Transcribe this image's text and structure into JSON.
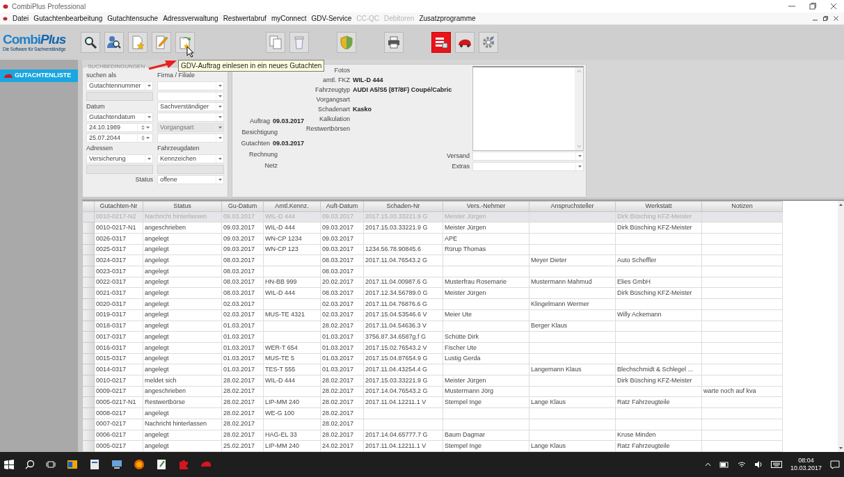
{
  "window": {
    "title": "CombiPlus Professional"
  },
  "menu": [
    {
      "label": "Datei",
      "disabled": false
    },
    {
      "label": "Gutachtenbearbeitung",
      "disabled": false
    },
    {
      "label": "Gutachtensuche",
      "disabled": false
    },
    {
      "label": "Adressverwaltung",
      "disabled": false
    },
    {
      "label": "Restwertabruf",
      "disabled": false
    },
    {
      "label": "myConnect",
      "disabled": false
    },
    {
      "label": "GDV-Service",
      "disabled": false
    },
    {
      "label": "CC-QC",
      "disabled": true
    },
    {
      "label": "Debitoren",
      "disabled": true
    },
    {
      "label": "Zusatzprogramme",
      "disabled": false
    }
  ],
  "logo": {
    "name": [
      "Combi",
      "Plus"
    ],
    "tagline": "Die Software für Sachverständige"
  },
  "toolbar": [
    {
      "kind": "search",
      "highlighted": false
    },
    {
      "kind": "person-search",
      "highlighted": false
    },
    {
      "kind": "new-document",
      "highlighted": false
    },
    {
      "kind": "edit",
      "highlighted": false
    },
    {
      "kind": "import",
      "highlighted": false
    },
    {
      "kind": "copy",
      "highlighted": false
    },
    {
      "kind": "trash",
      "highlighted": false
    },
    {
      "kind": "shield",
      "highlighted": false
    },
    {
      "kind": "print",
      "highlighted": false
    },
    {
      "kind": "list",
      "highlighted": true
    },
    {
      "kind": "car",
      "highlighted": false
    },
    {
      "kind": "gear",
      "highlighted": false
    }
  ],
  "tooltip": "GDV-Auftrag einlesen in ein neues Gutachten",
  "sidebar": {
    "items": [
      {
        "label": "GUTACHTENLISTE",
        "selected": true
      }
    ]
  },
  "search": {
    "legend": "SUCHBEDINGUNGEN",
    "rows": [
      [
        {
          "kind": "label",
          "text": "suchen als"
        },
        {
          "kind": "label",
          "text": "Firma / Filiale"
        }
      ],
      [
        {
          "kind": "select",
          "value": "Gutachtennummer"
        },
        {
          "kind": "select"
        }
      ],
      [
        {
          "kind": "input",
          "disabled": true
        },
        {
          "kind": "select"
        }
      ],
      [
        {
          "kind": "label",
          "text": "Datum"
        },
        {
          "kind": "select",
          "value": "Sachverständiger"
        }
      ],
      [
        {
          "kind": "select",
          "value": "Gutachtendatum"
        },
        {
          "kind": "select"
        }
      ],
      [
        {
          "kind": "date",
          "value": "24.10.1989"
        },
        {
          "kind": "select",
          "value": "Vorgangsart",
          "disabled": true
        }
      ],
      [
        {
          "kind": "date",
          "value": "25.07.2044"
        },
        {
          "kind": "select"
        }
      ],
      [
        {
          "kind": "label",
          "text": "Adressen"
        },
        {
          "kind": "label",
          "text": "Fahrzeugdaten"
        }
      ],
      [
        {
          "kind": "select",
          "value": "Versicherung"
        },
        {
          "kind": "select",
          "value": "Kennzeichen"
        }
      ],
      [
        {
          "kind": "input",
          "disabled": true
        },
        {
          "kind": "input",
          "disabled": true
        }
      ],
      [
        {
          "kind": "label_right",
          "text": "Status"
        },
        {
          "kind": "select",
          "value": "offene"
        }
      ]
    ]
  },
  "info": {
    "dates": [
      {
        "label": "Auftrag",
        "value": "09.03.2017"
      },
      {
        "label": "Besichtigung"
      },
      {
        "label": "Gutachten",
        "value": "09.03.2017"
      },
      {
        "label": "Rechnung"
      },
      {
        "label": "Netz"
      }
    ],
    "facts": [
      {
        "label": "Fotos"
      },
      {
        "label": "amtl. FKZ",
        "value": "WIL-D 444"
      },
      {
        "label": "Fahrzeugtyp",
        "value": "AUDI A5/S5 (8T/8F) Coupé/Cabric"
      },
      {
        "label": "Vorgangsart"
      },
      {
        "label": "Schadenart",
        "value": "Kasko"
      },
      {
        "label": "Kalkulation"
      },
      {
        "label": "Restwertbörsen"
      }
    ],
    "selects": [
      {
        "label": "Versand"
      },
      {
        "label": "Extras"
      }
    ]
  },
  "table": {
    "columns": [
      "Gutachten-Nr",
      "Status",
      "Gu-Datum",
      "Amtl.Kennz.",
      "Auft-Datum",
      "Schaden-Nr",
      "Vers.-Nehmer",
      "Anspruchsteller",
      "Werkstatt",
      "Notizen"
    ],
    "rows": [
      {
        "selected": true,
        "cells": [
          "0010-0217-N2",
          "Nachricht hinterlassen",
          "09.03.2017",
          "WIL-D 444",
          "09.03.2017",
          "2017.15.03.33221.9 G",
          "Meister Jürgen",
          null,
          "Dirk Büsching KFZ-Meister",
          null
        ]
      },
      {
        "selected": false,
        "cells": [
          "0010-0217-N1",
          "angeschrieben",
          "09.03.2017",
          "WIL-D 444",
          "09.03.2017",
          "2017.15.03.33221.9 G",
          "Meister Jürgen",
          null,
          "Dirk Büsching KFZ-Meister",
          null
        ]
      },
      {
        "selected": false,
        "cells": [
          "0026-0317",
          "angelegt",
          "09.03.2017",
          "WN-CP 1234",
          "09.03.2017",
          null,
          "APE",
          null,
          null,
          null
        ]
      },
      {
        "selected": false,
        "cells": [
          "0025-0317",
          "angelegt",
          "09.03.2017",
          "WN-CP 123",
          "09.03.2017",
          "1234.56.78.90845.6",
          "Rürup Thomas",
          null,
          null,
          null
        ]
      },
      {
        "selected": false,
        "cells": [
          "0024-0317",
          "angelegt",
          "08.03.2017",
          null,
          "08.03.2017",
          "2017.11.04.76543.2 G",
          null,
          "Meyer Dieter",
          "Auto Scheffler",
          null
        ]
      },
      {
        "selected": false,
        "cells": [
          "0023-0317",
          "angelegt",
          "08.03.2017",
          null,
          "08.03.2017",
          null,
          null,
          null,
          null,
          null
        ]
      },
      {
        "selected": false,
        "cells": [
          "0022-0317",
          "angelegt",
          "08.03.2017",
          "HN-BB 999",
          "20.02.2017",
          "2017.11.04.00987.6 G",
          "Musterfrau Rosemarie",
          "Mustermann Mahmud",
          "Elies GmbH",
          null
        ]
      },
      {
        "selected": false,
        "cells": [
          "0021-0317",
          "angelegt",
          "08.03.2017",
          "WIL-D 444",
          "08.03.2017",
          "2017.12.34.56789.0 G",
          "Meister Jürgen",
          null,
          "Dirk Büsching KFZ-Meister",
          null
        ]
      },
      {
        "selected": false,
        "cells": [
          "0020-0317",
          "angelegt",
          "02.03.2017",
          null,
          "02.03.2017",
          "2017.11.04.76876.6 G",
          null,
          "Klingelmann Wermer",
          null,
          null
        ]
      },
      {
        "selected": false,
        "cells": [
          "0019-0317",
          "angelegt",
          "02.03.2017",
          "MUS-TE 4321",
          "02.03.2017",
          "2017.15.04.53546.6 V",
          "Meier Ute",
          null,
          "Willy Ackemann",
          null
        ]
      },
      {
        "selected": false,
        "cells": [
          "0018-0317",
          "angelegt",
          "01.03.2017",
          null,
          "28.02.2017",
          "2017.11.04.54636.3 V",
          null,
          "Berger Klaus",
          null,
          null
        ]
      },
      {
        "selected": false,
        "cells": [
          "0017-0317",
          "angelegt",
          "01.03.2017",
          null,
          "01.03.2017",
          "3756.87.34.6587g.f G",
          "Schütte Dirk",
          null,
          null,
          null
        ]
      },
      {
        "selected": false,
        "cells": [
          "0016-0317",
          "angelegt",
          "01.03.2017",
          "WER-T 654",
          "01.03.2017",
          "2017.15.02.76543.2 V",
          "Fischer Ute",
          null,
          null,
          null
        ]
      },
      {
        "selected": false,
        "cells": [
          "0015-0317",
          "angelegt",
          "01.03.2017",
          "MUS-TE 5",
          "01.03.2017",
          "2017.15.04.87654.9 G",
          "Lustig Gerda",
          null,
          null,
          null
        ]
      },
      {
        "selected": false,
        "cells": [
          "0014-0317",
          "angelegt",
          "01.03.2017",
          "TES-T 555",
          "01.03.2017",
          "2017.11.04.43254.4 G",
          null,
          "Langemann Klaus",
          "Blechschmidt & Schlegel ...",
          null
        ]
      },
      {
        "selected": false,
        "cells": [
          "0010-0217",
          "meldet sich",
          "28.02.2017",
          "WIL-D 444",
          "28.02.2017",
          "2017.15.03.33221.9 G",
          "Meister Jürgen",
          null,
          "Dirk Büsching KFZ-Meister",
          null
        ]
      },
      {
        "selected": false,
        "cells": [
          "0009-0217",
          "angeschrieben",
          "28.02.2017",
          null,
          "28.02.2017",
          "2017.14.04.76543.2 G",
          "Mustermann Jörg",
          null,
          null,
          "warte noch auf kva"
        ]
      },
      {
        "selected": false,
        "cells": [
          "0005-0217-N1",
          "Restwertbörse",
          "28.02.2017",
          "LIP-MM 240",
          "28.02.2017",
          "2017.11.04.12211.1 V",
          "Stempel Inge",
          "Lange Klaus",
          "Ratz Fahrzeugteile",
          null
        ]
      },
      {
        "selected": false,
        "cells": [
          "0008-0217",
          "angelegt",
          "28.02.2017",
          "WE-G 100",
          "28.02.2017",
          null,
          null,
          null,
          null,
          null
        ]
      },
      {
        "selected": false,
        "cells": [
          "0007-0217",
          "Nachricht hinterlassen",
          "28.02.2017",
          null,
          "28.02.2017",
          null,
          null,
          null,
          null,
          null
        ]
      },
      {
        "selected": false,
        "cells": [
          "0006-0217",
          "angelegt",
          "28.02.2017",
          "HAG-EL 33",
          "28.02.2017",
          "2017.14.04.65777.7 G",
          "Baum Dagmar",
          null,
          "Kruse Minden",
          null
        ]
      },
      {
        "selected": false,
        "cells": [
          "0005-0217",
          "angelegt",
          "25.02.2017",
          "LIP-MM 240",
          "24.02.2017",
          "2017.11.04.12211.1 V",
          "Stempel Inge",
          "Lange Klaus",
          "Ratz Fahrzeugteile",
          null
        ]
      }
    ]
  },
  "taskbar": {
    "apps": [
      {
        "kind": "outlook"
      },
      {
        "kind": "document"
      },
      {
        "kind": "computer"
      },
      {
        "kind": "browser"
      },
      {
        "kind": "notepad"
      },
      {
        "kind": "puzzle"
      },
      {
        "kind": "car"
      }
    ],
    "time": "08:04",
    "date": "10.03.2017"
  }
}
